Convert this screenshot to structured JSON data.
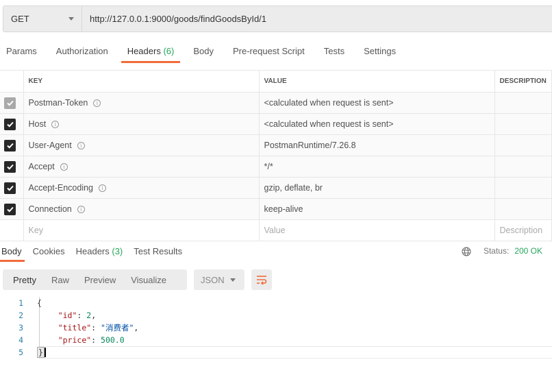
{
  "request": {
    "method": "GET",
    "url": "http://127.0.0.1:9000/goods/findGoodsById/1"
  },
  "tabs": [
    {
      "label": "Params"
    },
    {
      "label": "Authorization"
    },
    {
      "label": "Headers",
      "count": "(6)"
    },
    {
      "label": "Body"
    },
    {
      "label": "Pre-request Script"
    },
    {
      "label": "Tests"
    },
    {
      "label": "Settings"
    }
  ],
  "headers_table": {
    "columns": [
      "KEY",
      "VALUE",
      "DESCRIPTION"
    ],
    "rows": [
      {
        "key": "Postman-Token",
        "value": "<calculated when request is sent>",
        "checked": true,
        "disabled": true
      },
      {
        "key": "Host",
        "value": "<calculated when request is sent>",
        "checked": true
      },
      {
        "key": "User-Agent",
        "value": "PostmanRuntime/7.26.8",
        "checked": true
      },
      {
        "key": "Accept",
        "value": "*/*",
        "checked": true
      },
      {
        "key": "Accept-Encoding",
        "value": "gzip, deflate, br",
        "checked": true
      },
      {
        "key": "Connection",
        "value": "keep-alive",
        "checked": true
      }
    ],
    "placeholders": {
      "key": "Key",
      "value": "Value",
      "description": "Description"
    }
  },
  "response": {
    "tabs": [
      {
        "label": "Body"
      },
      {
        "label": "Cookies"
      },
      {
        "label": "Headers",
        "count": "(3)"
      },
      {
        "label": "Test Results"
      }
    ],
    "status_label": "Status:",
    "status_value": "200 OK",
    "view_modes": [
      "Pretty",
      "Raw",
      "Preview",
      "Visualize"
    ],
    "format": "JSON",
    "line_numbers": [
      "1",
      "2",
      "3",
      "4",
      "5"
    ],
    "body": {
      "id_key": "\"id\"",
      "id_val": "2",
      "title_key": "\"title\"",
      "title_val": "\"消费者\"",
      "price_key": "\"price\"",
      "price_val": "500.0"
    }
  },
  "colors": {
    "accent": "#f26b3a",
    "success": "#26a55b"
  }
}
